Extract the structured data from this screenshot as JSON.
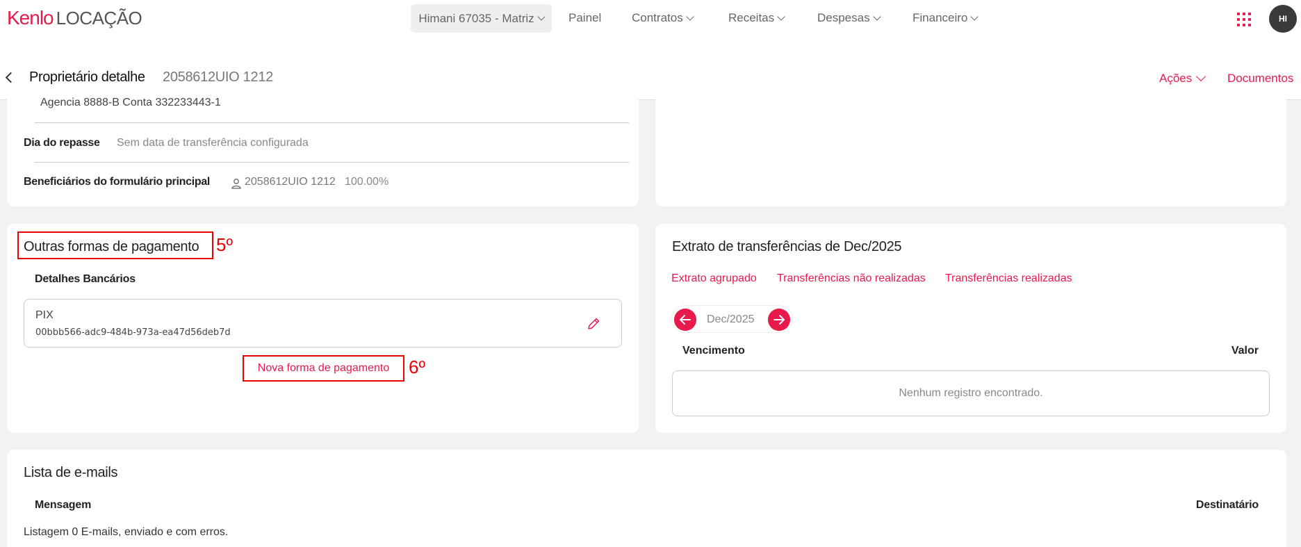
{
  "nav": {
    "brand": "Kenlo",
    "product": "LOCAÇÃO",
    "branch": "Himani 67035 - Matriz",
    "items": [
      "Painel",
      "Contratos",
      "Receitas",
      "Despesas",
      "Financeiro"
    ],
    "avatar": "HI"
  },
  "header": {
    "title": "Proprietário detalhe",
    "code": "2058612UIO 1212",
    "actions_label": "Ações",
    "documents_label": "Documentos"
  },
  "owner_info": {
    "bank_line": "Agencia 8888-B Conta 332233443-1",
    "transfer_day_label": "Dia do repasse",
    "transfer_day_value": "Sem data de transferência configurada",
    "beneficiaries_label": "Beneficiários do formulário principal",
    "beneficiary_name": "2058612UIO 1212",
    "beneficiary_percent": "100.00%"
  },
  "payment_methods": {
    "title": "Outras formas de pagamento",
    "step_marker": "5º",
    "bank_details_label": "Detalhes Bancários",
    "pix_label": "PIX",
    "pix_key": "00bbb566-adc9-484b-973a-ea47d56deb7d",
    "new_button": "Nova forma de pagamento",
    "new_step_marker": "6º"
  },
  "statement": {
    "title": "Extrato de transferências de Dec/2025",
    "tabs": [
      "Extrato agrupado",
      "Transferências não realizadas",
      "Transferências realizadas"
    ],
    "month": "Dec/2025",
    "col_due": "Vencimento",
    "col_value": "Valor",
    "empty": "Nenhum registro encontrado."
  },
  "emails": {
    "title": "Lista de e-mails",
    "col_message": "Mensagem",
    "col_recipient": "Destinatário",
    "summary": "Listagem 0 E-mails, enviado e com erros."
  },
  "colors": {
    "accent": "#e8194b",
    "highlight": "#ee0000"
  }
}
